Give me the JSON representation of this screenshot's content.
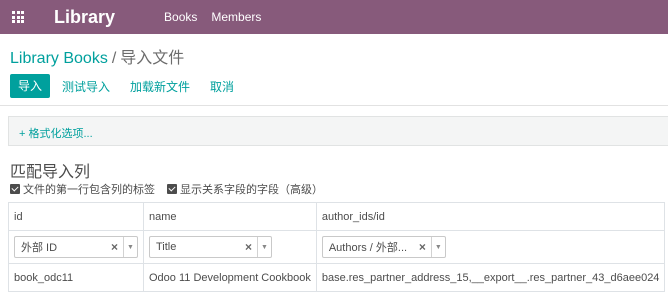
{
  "header": {
    "brand": "Library",
    "menu": [
      "Books",
      "Members"
    ]
  },
  "breadcrumb": {
    "parent": "Library Books",
    "separator": "/",
    "current": "导入文件"
  },
  "buttons": {
    "import": "导入",
    "test_import": "测试导入",
    "reload": "加载新文件",
    "cancel": "取消"
  },
  "options_link": "+ 格式化选项...",
  "section_title": "匹配导入列",
  "checkboxes": [
    {
      "label": "文件的第一行包含列的标签",
      "checked": true
    },
    {
      "label": "显示关系字段的字段（高级）",
      "checked": true
    }
  ],
  "table": {
    "headers": [
      "id",
      "name",
      "author_ids/id"
    ],
    "selects": [
      "外部 ID",
      "Title",
      "Authors / 外部..."
    ],
    "clear_glyph": "×",
    "arrow_glyph": "▼",
    "row": [
      "book_odc11",
      "Odoo 11 Development Cookbook",
      "base.res_partner_address_15,__export__.res_partner_43_d6aee024"
    ]
  },
  "colors": {
    "navbar": "#875a7b",
    "accent": "#00a09d",
    "options_bar": "#f4f5f5"
  },
  "icons": {
    "apps": "apps-grid-icon",
    "checkbox": "checkbox-checked-icon"
  }
}
